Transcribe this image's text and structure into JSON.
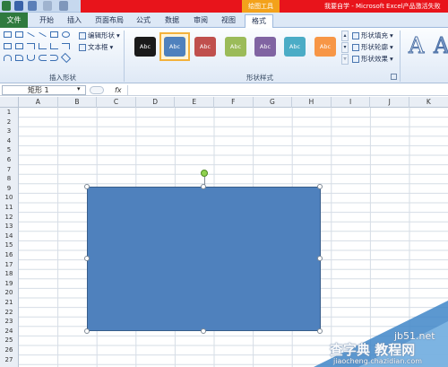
{
  "titlebar": {
    "contextual_tab_title": "绘图工具",
    "app_title": "我要自学 - Microsoft Excel产品激活失败"
  },
  "tabs": {
    "file": "文件",
    "items": [
      "开始",
      "插入",
      "页面布局",
      "公式",
      "数据",
      "审阅",
      "视图",
      "格式"
    ],
    "active": "格式"
  },
  "ribbon": {
    "insert_shapes": {
      "edit_shape": "编辑形状",
      "text_box": "文本框",
      "label": "插入形状"
    },
    "shape_styles": {
      "style_text": "Abc",
      "styles": [
        {
          "name": "black-style",
          "color": "#1a1a1a"
        },
        {
          "name": "blue-style",
          "color": "#4f81bd"
        },
        {
          "name": "red-style",
          "color": "#c0504d"
        },
        {
          "name": "green-style",
          "color": "#9bbb59"
        },
        {
          "name": "purple-style",
          "color": "#8064a2"
        },
        {
          "name": "aqua-style",
          "color": "#4bacc6"
        },
        {
          "name": "orange-style",
          "color": "#f79646"
        }
      ],
      "selected": "blue-style",
      "fill": "形状填充",
      "outline": "形状轮廓",
      "effects": "形状效果",
      "label": "形状样式"
    },
    "wordart_text": "A"
  },
  "formula_bar": {
    "name_box": "矩形 1",
    "fx": "fx"
  },
  "columns": [
    "A",
    "B",
    "C",
    "D",
    "E",
    "F",
    "G",
    "H",
    "I",
    "J",
    "K"
  ],
  "rows": [
    "1",
    "2",
    "3",
    "4",
    "5",
    "6",
    "7",
    "8",
    "9",
    "10",
    "11",
    "12",
    "13",
    "14",
    "15",
    "16",
    "17",
    "18",
    "19",
    "20",
    "21",
    "22",
    "23",
    "24",
    "25",
    "26",
    "27"
  ],
  "shape": {
    "name": "rectangle-shape",
    "fill": "#4f81bd"
  },
  "watermark": {
    "line1": "jb51.net",
    "line2": "查字典 教程网",
    "line3": "jiaocheng.chazidian.com"
  }
}
